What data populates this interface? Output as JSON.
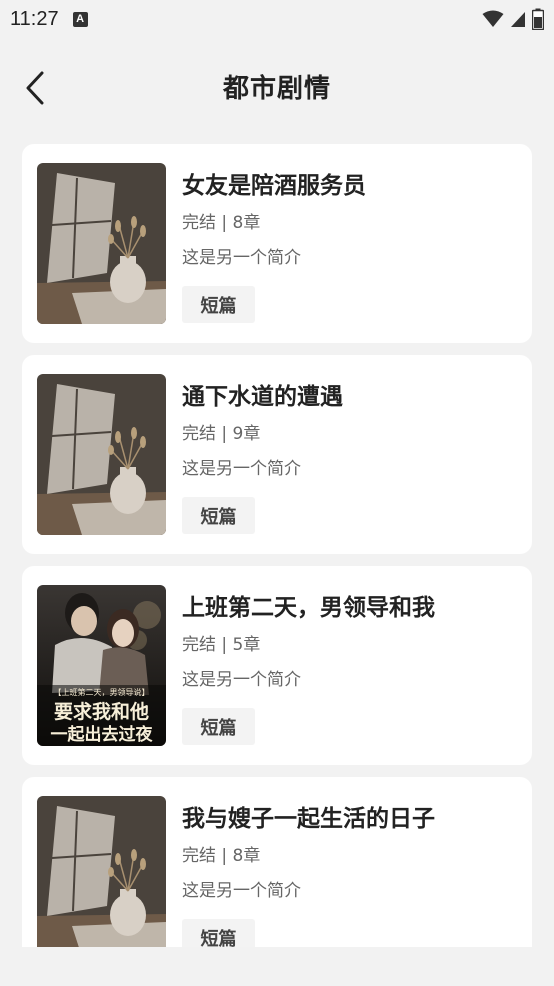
{
  "status_bar": {
    "time": "11:27",
    "app_icon": "A",
    "icons": [
      "wifi-icon",
      "cellular-signal-icon",
      "battery-icon"
    ]
  },
  "header": {
    "back_icon": "chevron-left-icon",
    "title": "都市剧情"
  },
  "books": [
    {
      "title": "女友是陪酒服务员",
      "status": "完结",
      "separator": "|",
      "chapters": "8章",
      "description": "这是另一个简介",
      "tag": "短篇",
      "cover": "vase-still-life"
    },
    {
      "title": "通下水道的遭遇",
      "status": "完结",
      "separator": "|",
      "chapters": "9章",
      "description": "这是另一个简介",
      "tag": "短篇",
      "cover": "vase-still-life"
    },
    {
      "title": "上班第二天，男领导和我",
      "status": "完结",
      "separator": "|",
      "chapters": "5章",
      "description": "这是另一个简介",
      "tag": "短篇",
      "cover": "couple-poster",
      "cover_text": {
        "line1": "【上班第二天，男领导说】",
        "line2": "要求我和他",
        "line3": "一起出去过夜"
      }
    },
    {
      "title": "我与嫂子一起生活的日子",
      "status": "完结",
      "separator": "|",
      "chapters": "8章",
      "description": "这是另一个简介",
      "tag": "短篇",
      "cover": "vase-still-life"
    }
  ]
}
